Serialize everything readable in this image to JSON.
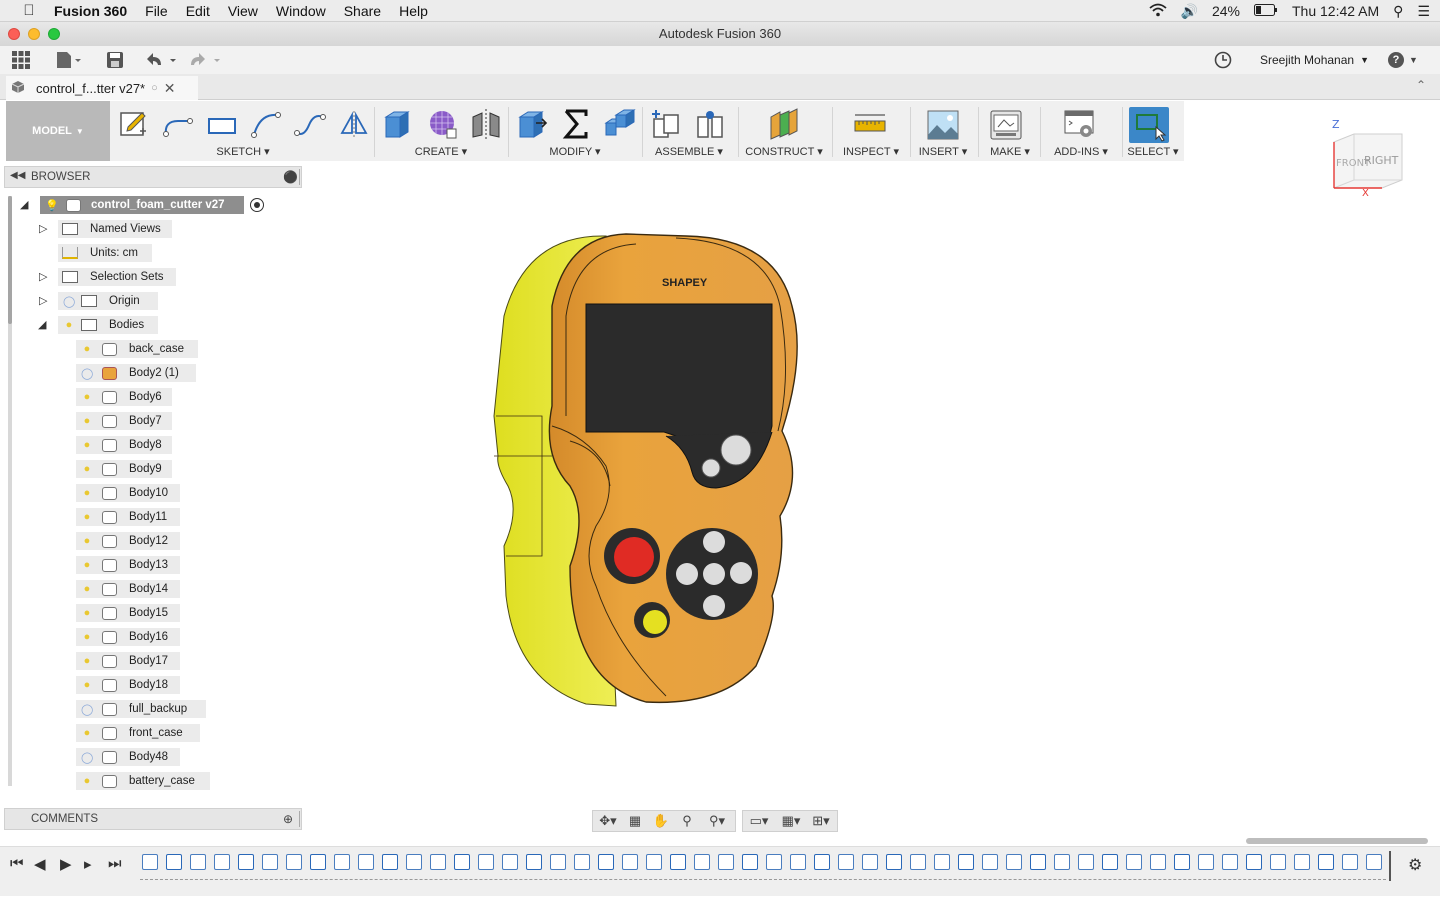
{
  "menubar": {
    "app_name": "Fusion 360",
    "items": [
      "File",
      "Edit",
      "View",
      "Window",
      "Share",
      "Help"
    ],
    "battery": "24%",
    "clock": "Thu 12:42 AM"
  },
  "window": {
    "title": "Autodesk Fusion 360"
  },
  "apptoolbar": {
    "user_name": "Sreejith Mohanan",
    "help_label": "?"
  },
  "doc_tab": {
    "title": "control_f...tter v27*"
  },
  "ribbon": {
    "workspace": "MODEL",
    "groups": [
      "SKETCH",
      "CREATE",
      "MODIFY",
      "ASSEMBLE",
      "CONSTRUCT",
      "INSPECT",
      "INSERT",
      "MAKE",
      "ADD-INS",
      "SELECT"
    ]
  },
  "browser": {
    "header": "BROWSER",
    "root": "control_foam_cutter v27",
    "nodes": [
      "Named Views",
      "Units: cm",
      "Selection Sets",
      "Origin",
      "Bodies"
    ],
    "bodies": [
      "back_case",
      "Body2 (1)",
      "Body6",
      "Body7",
      "Body8",
      "Body9",
      "Body10",
      "Body11",
      "Body12",
      "Body13",
      "Body14",
      "Body15",
      "Body16",
      "Body17",
      "Body18",
      "full_backup",
      "front_case",
      "Body48",
      "battery_case"
    ]
  },
  "viewport": {
    "logo_text": "SHAPEY"
  },
  "viewcube": {
    "front": "FRONT",
    "right": "RIGHT",
    "z": "Z",
    "x": "X"
  },
  "comments": {
    "header": "COMMENTS"
  },
  "colors": {
    "body": "#e9a33c",
    "side": "#e3e02a",
    "screen": "#2b2b2b",
    "red_button": "#e02b24",
    "select_blue": "#3b87c8"
  }
}
